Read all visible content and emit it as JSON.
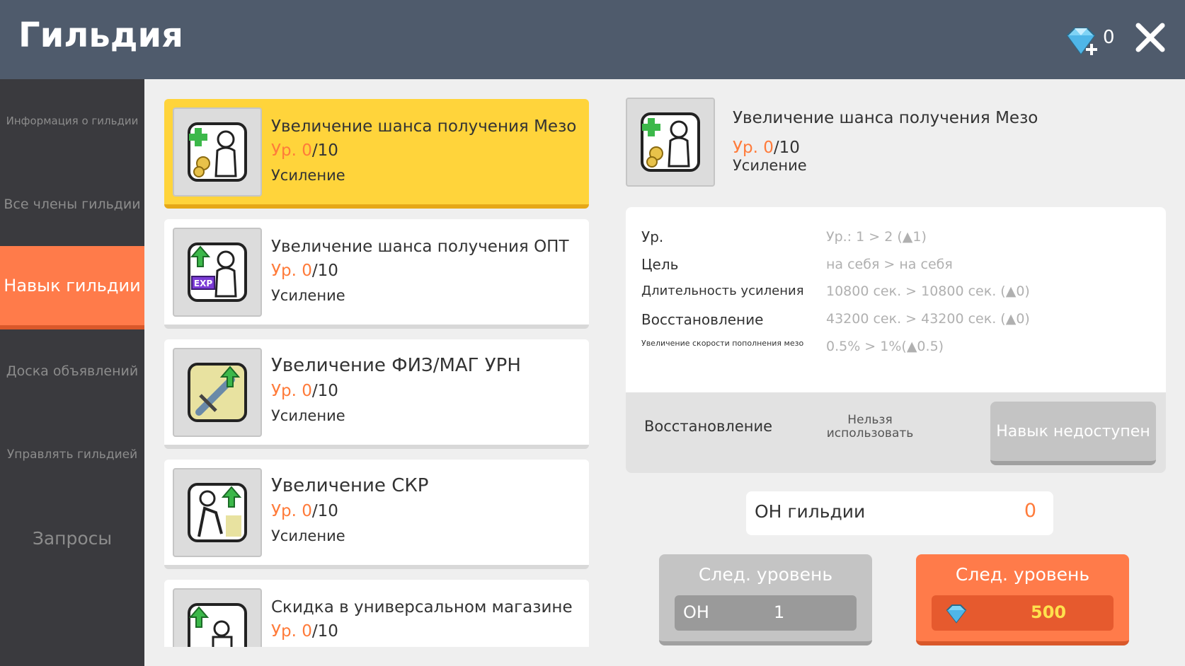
{
  "header": {
    "title": "Гильдия",
    "gem_count": "0",
    "gem_icon": "diamond-plus-icon",
    "close_icon": "close-icon"
  },
  "sidebar": {
    "items": [
      {
        "label": "Информация о гильдии",
        "active": false
      },
      {
        "label": "Все члены гильдии",
        "active": false
      },
      {
        "label": "Навык гильдии",
        "active": true
      },
      {
        "label": "Доска объявлений",
        "active": false
      },
      {
        "label": "Управлять гильдией",
        "active": false
      },
      {
        "label": "Запросы",
        "active": false
      }
    ]
  },
  "skills": [
    {
      "name": "Увеличение шанса получения Мезо",
      "level_prefix": "Ур. ",
      "level_current": "0",
      "level_max": "/10",
      "type": "Усиление",
      "icon": "meso-buff-icon",
      "selected": true
    },
    {
      "name": "Увеличение шанса получения ОПТ",
      "level_prefix": "Ур. ",
      "level_current": "0",
      "level_max": "/10",
      "type": "Усиление",
      "icon": "exp-buff-icon",
      "selected": false
    },
    {
      "name": "Увеличение ФИЗ/МАГ УРН",
      "level_prefix": "Ур. ",
      "level_current": "0",
      "level_max": "/10",
      "type": "Усиление",
      "icon": "damage-buff-icon",
      "selected": false
    },
    {
      "name": "Увеличение СКР",
      "level_prefix": "Ур. ",
      "level_current": "0",
      "level_max": "/10",
      "type": "Усиление",
      "icon": "speed-buff-icon",
      "selected": false
    },
    {
      "name": "Скидка в универсальном магазине",
      "level_prefix": "Ур. ",
      "level_current": "0",
      "level_max": "/10",
      "type": "",
      "icon": "shop-discount-icon",
      "selected": false
    }
  ],
  "detail": {
    "name": "Увеличение шанса получения Мезо",
    "level_prefix": "Ур. ",
    "level_current": "0",
    "level_max": "/10",
    "type": "Усиление",
    "stats": [
      {
        "label": "Ур.",
        "value": "Ур.: 1 > 2 (▲1)"
      },
      {
        "label": "Цель",
        "value": "на себя > на себя"
      },
      {
        "label": "Длительность усиления",
        "value": "10800 сек. > 10800 сек. (▲0)"
      },
      {
        "label": "Восстановление",
        "value": "43200 сек. > 43200 сек. (▲0)"
      },
      {
        "label": "Увеличение скорости пополнения мезо",
        "value": "0.5%  >  1%(▲0.5)"
      }
    ],
    "footer_label": "Восстановление",
    "footer_status": "Нельзя использовать",
    "unavailable_button": "Навык недоступен"
  },
  "guild_points": {
    "label": "ОН гильдии",
    "value": "0"
  },
  "next_level_buttons": [
    {
      "title": "След. уровень",
      "cost_label": "ОН",
      "cost_value": "1"
    },
    {
      "title": "След. уровень",
      "cost_icon": "diamond-icon",
      "cost_value": "500"
    }
  ],
  "colors": {
    "header_bg": "#4f5b6c",
    "accent_orange": "#ff7b4a",
    "selected_yellow": "#ffd43b",
    "level_orange": "#ff7b3a"
  }
}
